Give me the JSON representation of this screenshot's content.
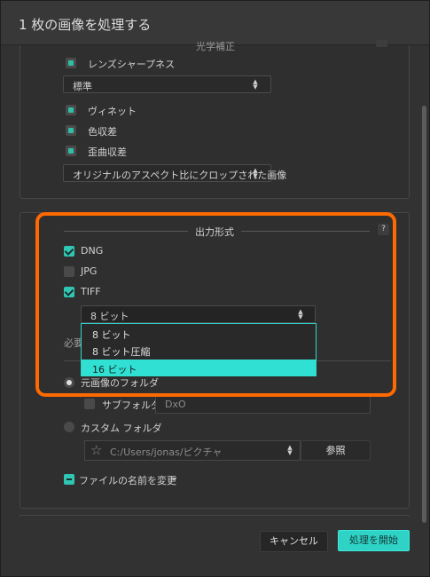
{
  "window": {
    "title": "1 枚の画像を処理する"
  },
  "lens_panel": {
    "partial_header": "光学補正",
    "lens_sharpness_label": "レンズシャープネス",
    "sharpness_select_value": "標準",
    "vignette_label": "ヴィネット",
    "chromatic_label": "色収差",
    "distortion_label": "歪曲収差",
    "crop_select_value": "オリジナルのアスペクト比にクロップされた画像"
  },
  "output_panel": {
    "header": "出力形式",
    "help": "?",
    "formats": [
      {
        "label": "DNG",
        "checked": true
      },
      {
        "label": "JPG",
        "checked": false
      },
      {
        "label": "TIFF",
        "checked": true
      }
    ],
    "bit_select_value": "8 ビット",
    "bit_options": [
      {
        "label": "8 ビット",
        "selected": false
      },
      {
        "label": "8 ビット圧縮",
        "selected": false
      },
      {
        "label": "16 ビット",
        "selected": true
      }
    ],
    "obscured_label": "必要",
    "source_folder_label": "元画像のフォルダ",
    "subfolder_label": "サブフォルダ",
    "subfolder_value": "DxO",
    "custom_folder_label": "カスタム フォルダ",
    "custom_path_value": "C:/Users/jonas/ピクチャ",
    "browse_label": "参照",
    "rename_label": "ファイルの名前を変更"
  },
  "footer": {
    "cancel_label": "キャンセル",
    "start_label": "処理を開始"
  },
  "colors": {
    "accent": "#2fd3c6",
    "highlight": "#ff6a00"
  }
}
